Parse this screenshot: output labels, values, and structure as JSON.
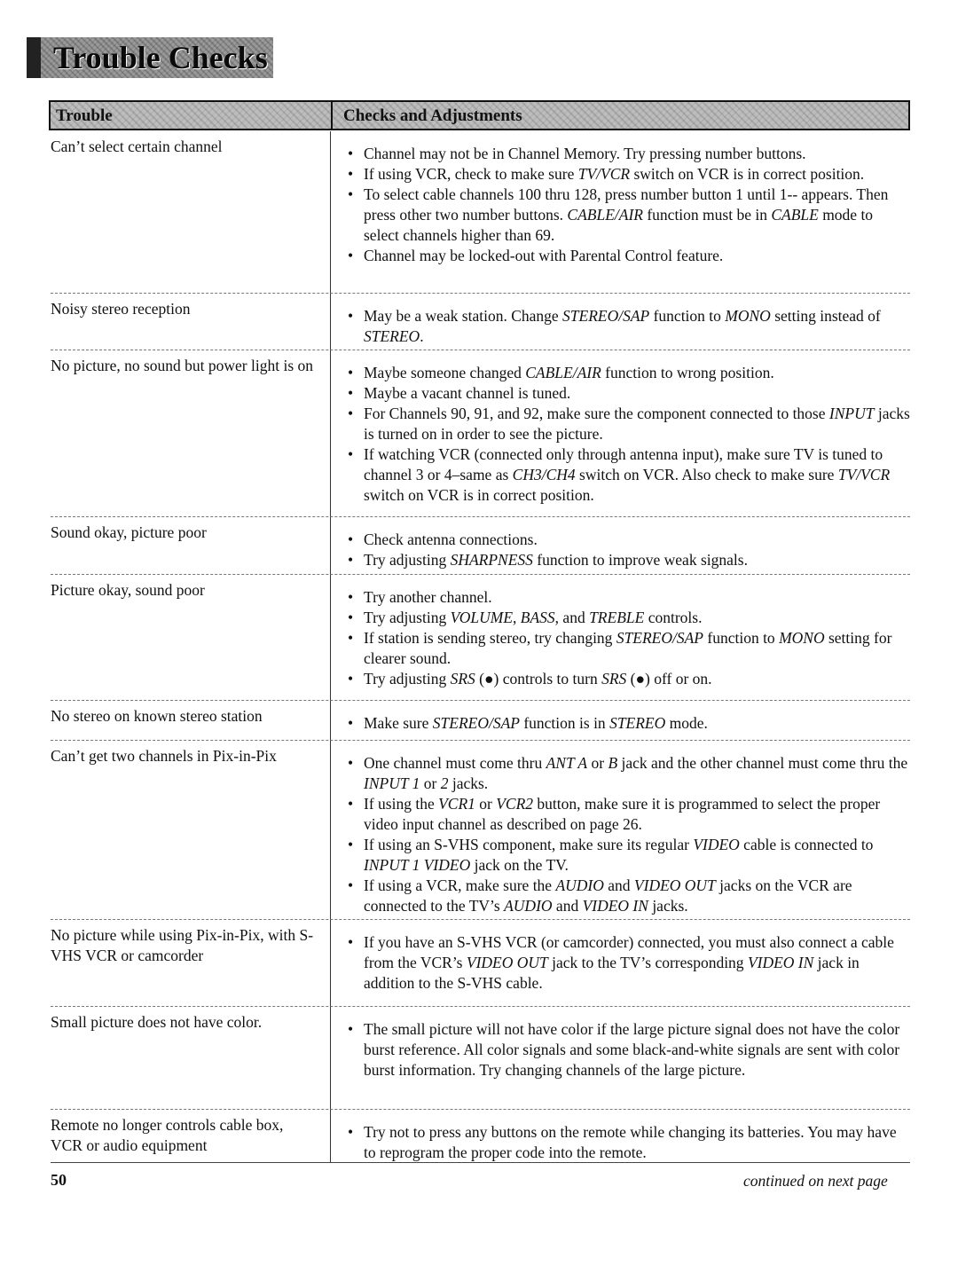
{
  "page": {
    "title": "Trouble Checks",
    "page_number": "50",
    "continued": "continued on next page"
  },
  "table": {
    "headers": {
      "trouble": "Trouble",
      "checks": "Checks and Adjustments"
    },
    "rows": [
      {
        "trouble": "Can’t select certain channel",
        "checks": [
          "Channel may not be in Channel Memory.  Try pressing number buttons.",
          "If using VCR, check to make sure <i>TV/VCR</i> switch on VCR is in correct position.",
          "To select cable channels 100 thru 128, press number button 1 until 1-- appears.  Then press other two number buttons.  <i>CABLE/AIR</i> function must be in <i>CABLE</i> mode to select channels higher than 69.",
          "Channel may be locked-out with Parental Control feature."
        ]
      },
      {
        "trouble": "Noisy stereo reception",
        "checks": [
          "May be a weak station.  Change <i>STEREO/SAP</i> function to <i>MONO</i> setting instead of <i>STEREO</i>."
        ]
      },
      {
        "trouble": "No picture, no sound but power light is on",
        "checks": [
          "Maybe someone changed <i>CABLE/AIR</i> function to wrong position.",
          "Maybe a vacant channel is tuned.",
          "For Channels 90, 91, and 92, make sure the component connected to those <i>INPUT</i> jacks is turned on in order to see the picture.",
          "If watching VCR (connected only through antenna input), make sure TV is tuned to channel 3 or 4–same as <i>CH3/CH4</i> switch on VCR.  Also check to make sure <i>TV/VCR</i> switch on VCR is in correct position."
        ]
      },
      {
        "trouble": "Sound okay, picture poor",
        "checks": [
          "Check antenna connections.",
          "Try adjusting <i>SHARPNESS</i> function to improve weak signals."
        ]
      },
      {
        "trouble": "Picture okay, sound poor",
        "checks": [
          "Try another channel.",
          "Try adjusting <i>VOLUME</i>, <i>BASS</i>, and <i>TREBLE</i> controls.",
          "If station is sending stereo, try changing <i>STEREO/SAP</i> function to <i>MONO</i> setting for clearer sound.",
          "Try adjusting <i>SRS</i> (●) controls to turn <i>SRS</i> (●) off or on."
        ]
      },
      {
        "trouble": "No stereo on known stereo station",
        "checks": [
          "Make sure <i>STEREO/SAP</i> function is in <i>STEREO</i> mode."
        ]
      },
      {
        "trouble": "Can’t get two channels in Pix-in-Pix",
        "checks": [
          "One channel must come thru <i>ANT A</i> or <i>B</i> jack and the other channel must come thru the <i>INPUT 1</i> or <i>2</i> jacks.",
          "If using the <i>VCR1</i> or <i>VCR2</i> button, make sure it is programmed to select the proper video input channel as described on page 26.",
          "If using an S-VHS component, make sure its regular <i>VIDEO</i> cable is connected to <i>INPUT 1 VIDEO</i> jack on the TV.",
          "If using a VCR, make sure the <i>AUDIO</i> and <i>VIDEO OUT</i> jacks on the VCR are connected to the TV’s <i>AUDIO</i> and <i>VIDEO IN</i> jacks."
        ]
      },
      {
        "trouble": "No picture while using Pix-in-Pix, with S-VHS VCR or camcorder",
        "checks": [
          "If you have an S-VHS VCR (or camcorder) connected, you must also connect a cable from the VCR’s <i>VIDEO OUT</i> jack to the TV’s corresponding <i>VIDEO IN</i> jack in addition to the S-VHS cable."
        ]
      },
      {
        "trouble": "Small picture does not have color.",
        "checks": [
          "The small picture will not have color if the large picture signal does not have the color burst reference.  All color signals and some black-and-white signals are sent with color burst information.  Try changing channels of the large picture."
        ]
      },
      {
        "trouble": "Remote no longer controls cable box, VCR or audio equipment",
        "checks": [
          "Try not to press any buttons on the remote while changing its batteries.  You may have to reprogram the proper code into the remote."
        ]
      }
    ]
  }
}
